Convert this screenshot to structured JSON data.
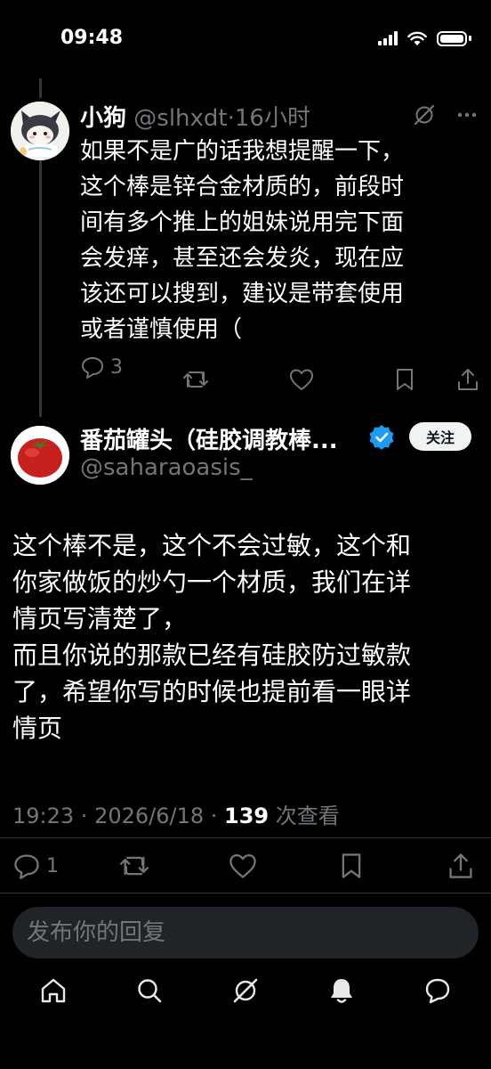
{
  "status_bar": {
    "time": "09:48"
  },
  "reply_post": {
    "author_name": "小狗",
    "handle": "@slhxdt",
    "separator": "·",
    "time_ago": "16小时",
    "body_lines": [
      "如果不是广的话我想提醒一下，",
      "这个棒是锌合金材质的，前段时",
      "间有多个推上的姐妹说用完下面",
      "会发痒，甚至还会发炎，现在应",
      "该还可以搜到，建议是带套使用",
      "或者谨慎使用（"
    ],
    "reply_count": "3"
  },
  "main_post": {
    "author_name": "番茄罐头（硅胶调教棒...",
    "handle": "@saharaoasis_",
    "follow_label": "关注",
    "body_lines": [
      "这个棒不是，这个不会过敏，这个和",
      "你家做饭的炒勺一个材质，我们在详",
      "情页写清楚了，",
      "而且你说的那款已经有硅胶防过敏款",
      "了，希望你写的时候也提前看一眼详",
      "情页"
    ],
    "time": "19:23",
    "separator": " · ",
    "date": "2026/6/18",
    "separator2": " · ",
    "views": "139",
    "views_label": " 次查看",
    "reply_count": "1"
  },
  "reply_box": {
    "placeholder": "发布你的回复"
  },
  "colors": {
    "accent": "#1d9bf0",
    "muted": "#71767b",
    "background": "#000000"
  }
}
